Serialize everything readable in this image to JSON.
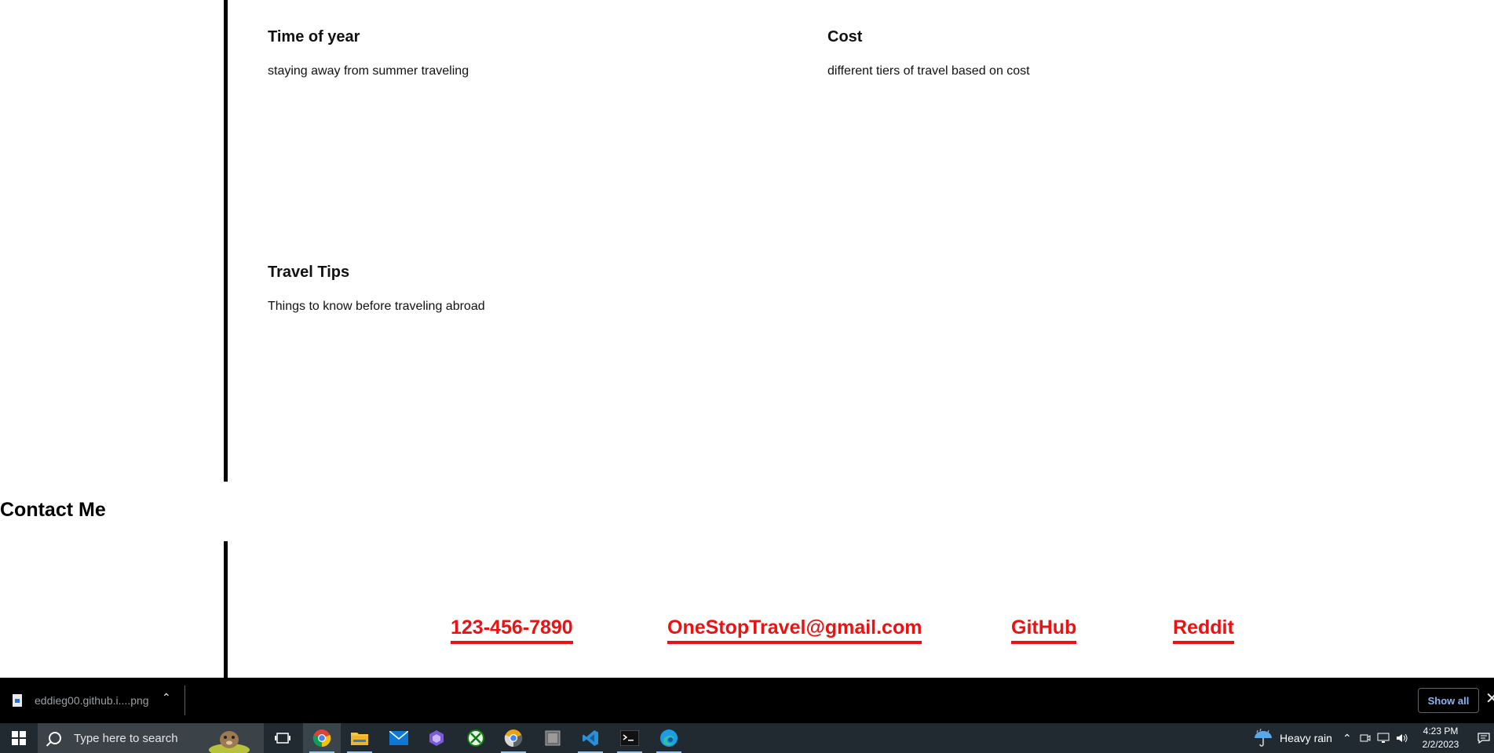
{
  "sections": [
    {
      "title": "Time of year",
      "text": "staying away from summer traveling"
    },
    {
      "title": "Cost",
      "text": "different tiers of travel based on cost"
    },
    {
      "title": "Travel Tips",
      "text": "Things to know before traveling abroad"
    }
  ],
  "contact": {
    "heading": "Contact Me",
    "links": [
      {
        "label": "123-456-7890"
      },
      {
        "label": "OneStopTravel@gmail.com"
      },
      {
        "label": "GitHub"
      },
      {
        "label": "Reddit"
      }
    ],
    "link_color": "#ee1111"
  },
  "download_bar": {
    "filename": "eddieg00.github.i....png",
    "show_all_label": "Show all"
  },
  "taskbar": {
    "search_placeholder": "Type here to search",
    "weather": "Heavy rain",
    "time": "4:23 PM",
    "date": "2/2/2023",
    "apps": [
      "task-view",
      "chrome",
      "file-explorer",
      "mail",
      "copilot",
      "xbox",
      "chrome-dev",
      "app-window",
      "vscode",
      "terminal",
      "edge"
    ]
  }
}
